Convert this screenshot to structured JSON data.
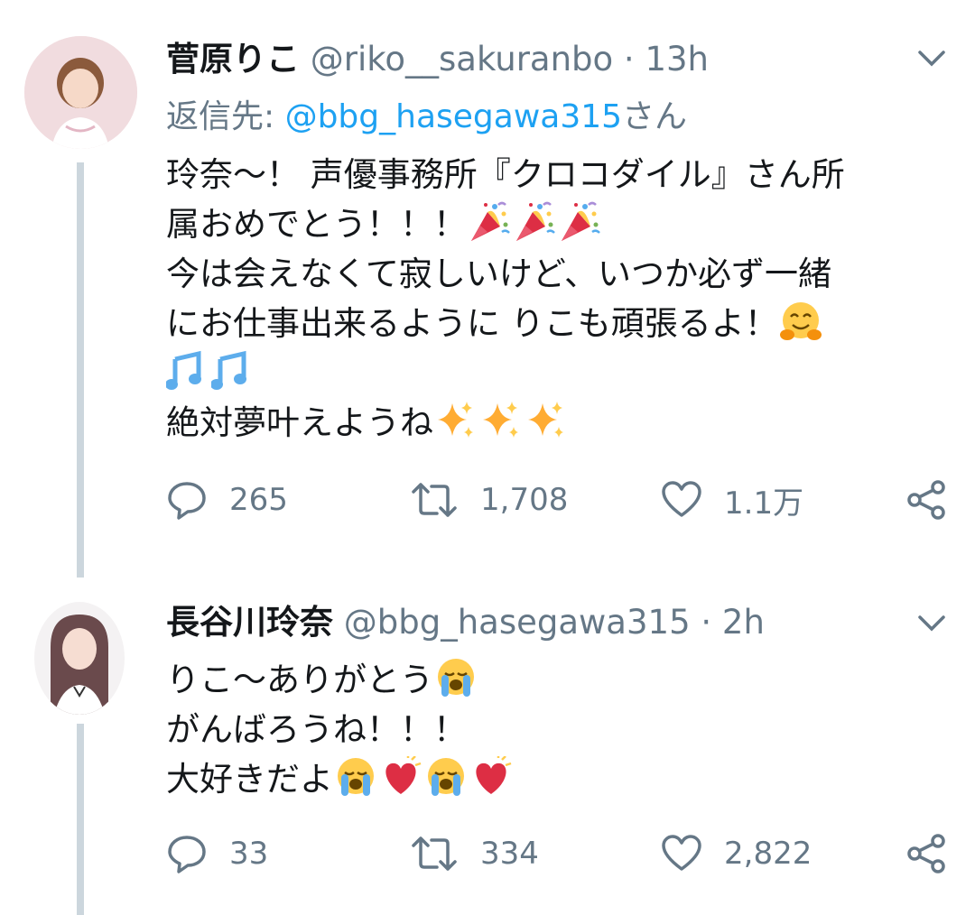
{
  "tweets": [
    {
      "name": "菅原りこ",
      "handle": "@riko__sakuranbo",
      "separator": "·",
      "time": "13h",
      "reply_prefix": "返信先: ",
      "reply_mention": "@bbg_hasegawa315",
      "reply_suffix": "さん",
      "lines": [
        "玲奈〜！ 声優事務所『クロコダイル』さん所",
        "属おめでとう！！！",
        "今は会えなくて寂しいけど、いつか必ず一緒",
        "にお仕事出来るように りこも頑張るよ！",
        "",
        "絶対夢叶えようね"
      ],
      "emoji": [
        "party-popper",
        "hugging-face",
        "musical-notes",
        "sparkles"
      ],
      "replies": "265",
      "retweets": "1,708",
      "likes": "1.1万"
    },
    {
      "name": "長谷川玲奈",
      "handle": "@bbg_hasegawa315",
      "separator": "·",
      "time": "2h",
      "lines": [
        "りこ〜ありがとう",
        "がんばろうね！！！",
        "大好きだよ"
      ],
      "emoji": [
        "loudly-crying-face",
        "red-heart"
      ],
      "replies": "33",
      "retweets": "334",
      "likes": "2,822"
    }
  ],
  "colors": {
    "text": "#14171a",
    "secondary": "#657786",
    "link": "#1da1f2",
    "thread_line": "#ccd6dd"
  }
}
